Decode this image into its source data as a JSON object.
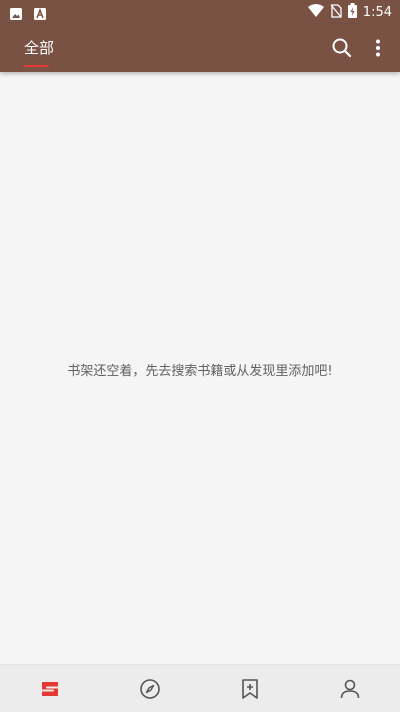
{
  "status_bar": {
    "time": "1:54",
    "icons": [
      "image-icon",
      "a-letter-icon",
      "wifi-icon",
      "no-sim-icon",
      "battery-charging-icon"
    ]
  },
  "app_bar": {
    "tabs": [
      {
        "label": "全部",
        "selected": true
      }
    ],
    "actions": [
      "search-icon",
      "more-vert-icon"
    ],
    "accent_color": "#e53935",
    "bar_color": "#7a5244"
  },
  "main": {
    "empty_message": "书架还空着，先去搜索书籍或从发现里添加吧!"
  },
  "bottom_nav": {
    "items": [
      {
        "name": "bookshelf",
        "icon": "bookshelf-logo-icon",
        "selected": true
      },
      {
        "name": "discover",
        "icon": "compass-icon",
        "selected": false
      },
      {
        "name": "bookmark",
        "icon": "bookmark-add-icon",
        "selected": false
      },
      {
        "name": "profile",
        "icon": "person-icon",
        "selected": false
      }
    ]
  }
}
